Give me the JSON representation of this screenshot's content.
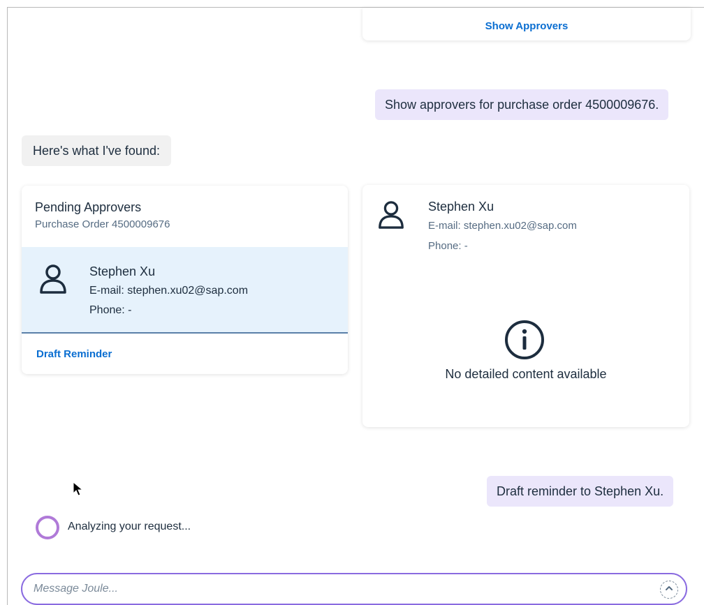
{
  "top_card": {
    "link_label": "Show Approvers"
  },
  "messages": {
    "user_1": "Show approvers for purchase order 4500009676.",
    "bot_1": "Here's what I've found:",
    "user_2": "Draft reminder to Stephen Xu."
  },
  "approvers_card": {
    "title": "Pending Approvers",
    "subtitle": "Purchase Order 4500009676",
    "approver": {
      "name": "Stephen Xu",
      "email": "E-mail: stephen.xu02@sap.com",
      "phone": "Phone: -"
    },
    "action_label": "Draft Reminder"
  },
  "detail_card": {
    "name": "Stephen Xu",
    "email": "E-mail: stephen.xu02@sap.com",
    "phone": "Phone: -",
    "empty_text": "No detailed content available"
  },
  "status": {
    "text": "Analyzing your request..."
  },
  "composer": {
    "placeholder": "Message Joule..."
  },
  "colors": {
    "accent": "#0a6ed1",
    "user_bubble": "#ebe6fb",
    "selected_row": "#e6f2fc",
    "spinner": "#b07ad8",
    "input_border": "#8a6be0"
  },
  "icons": {
    "person": "person-icon",
    "info": "info-icon",
    "send": "send-icon",
    "cursor": "mouse-cursor-icon"
  }
}
